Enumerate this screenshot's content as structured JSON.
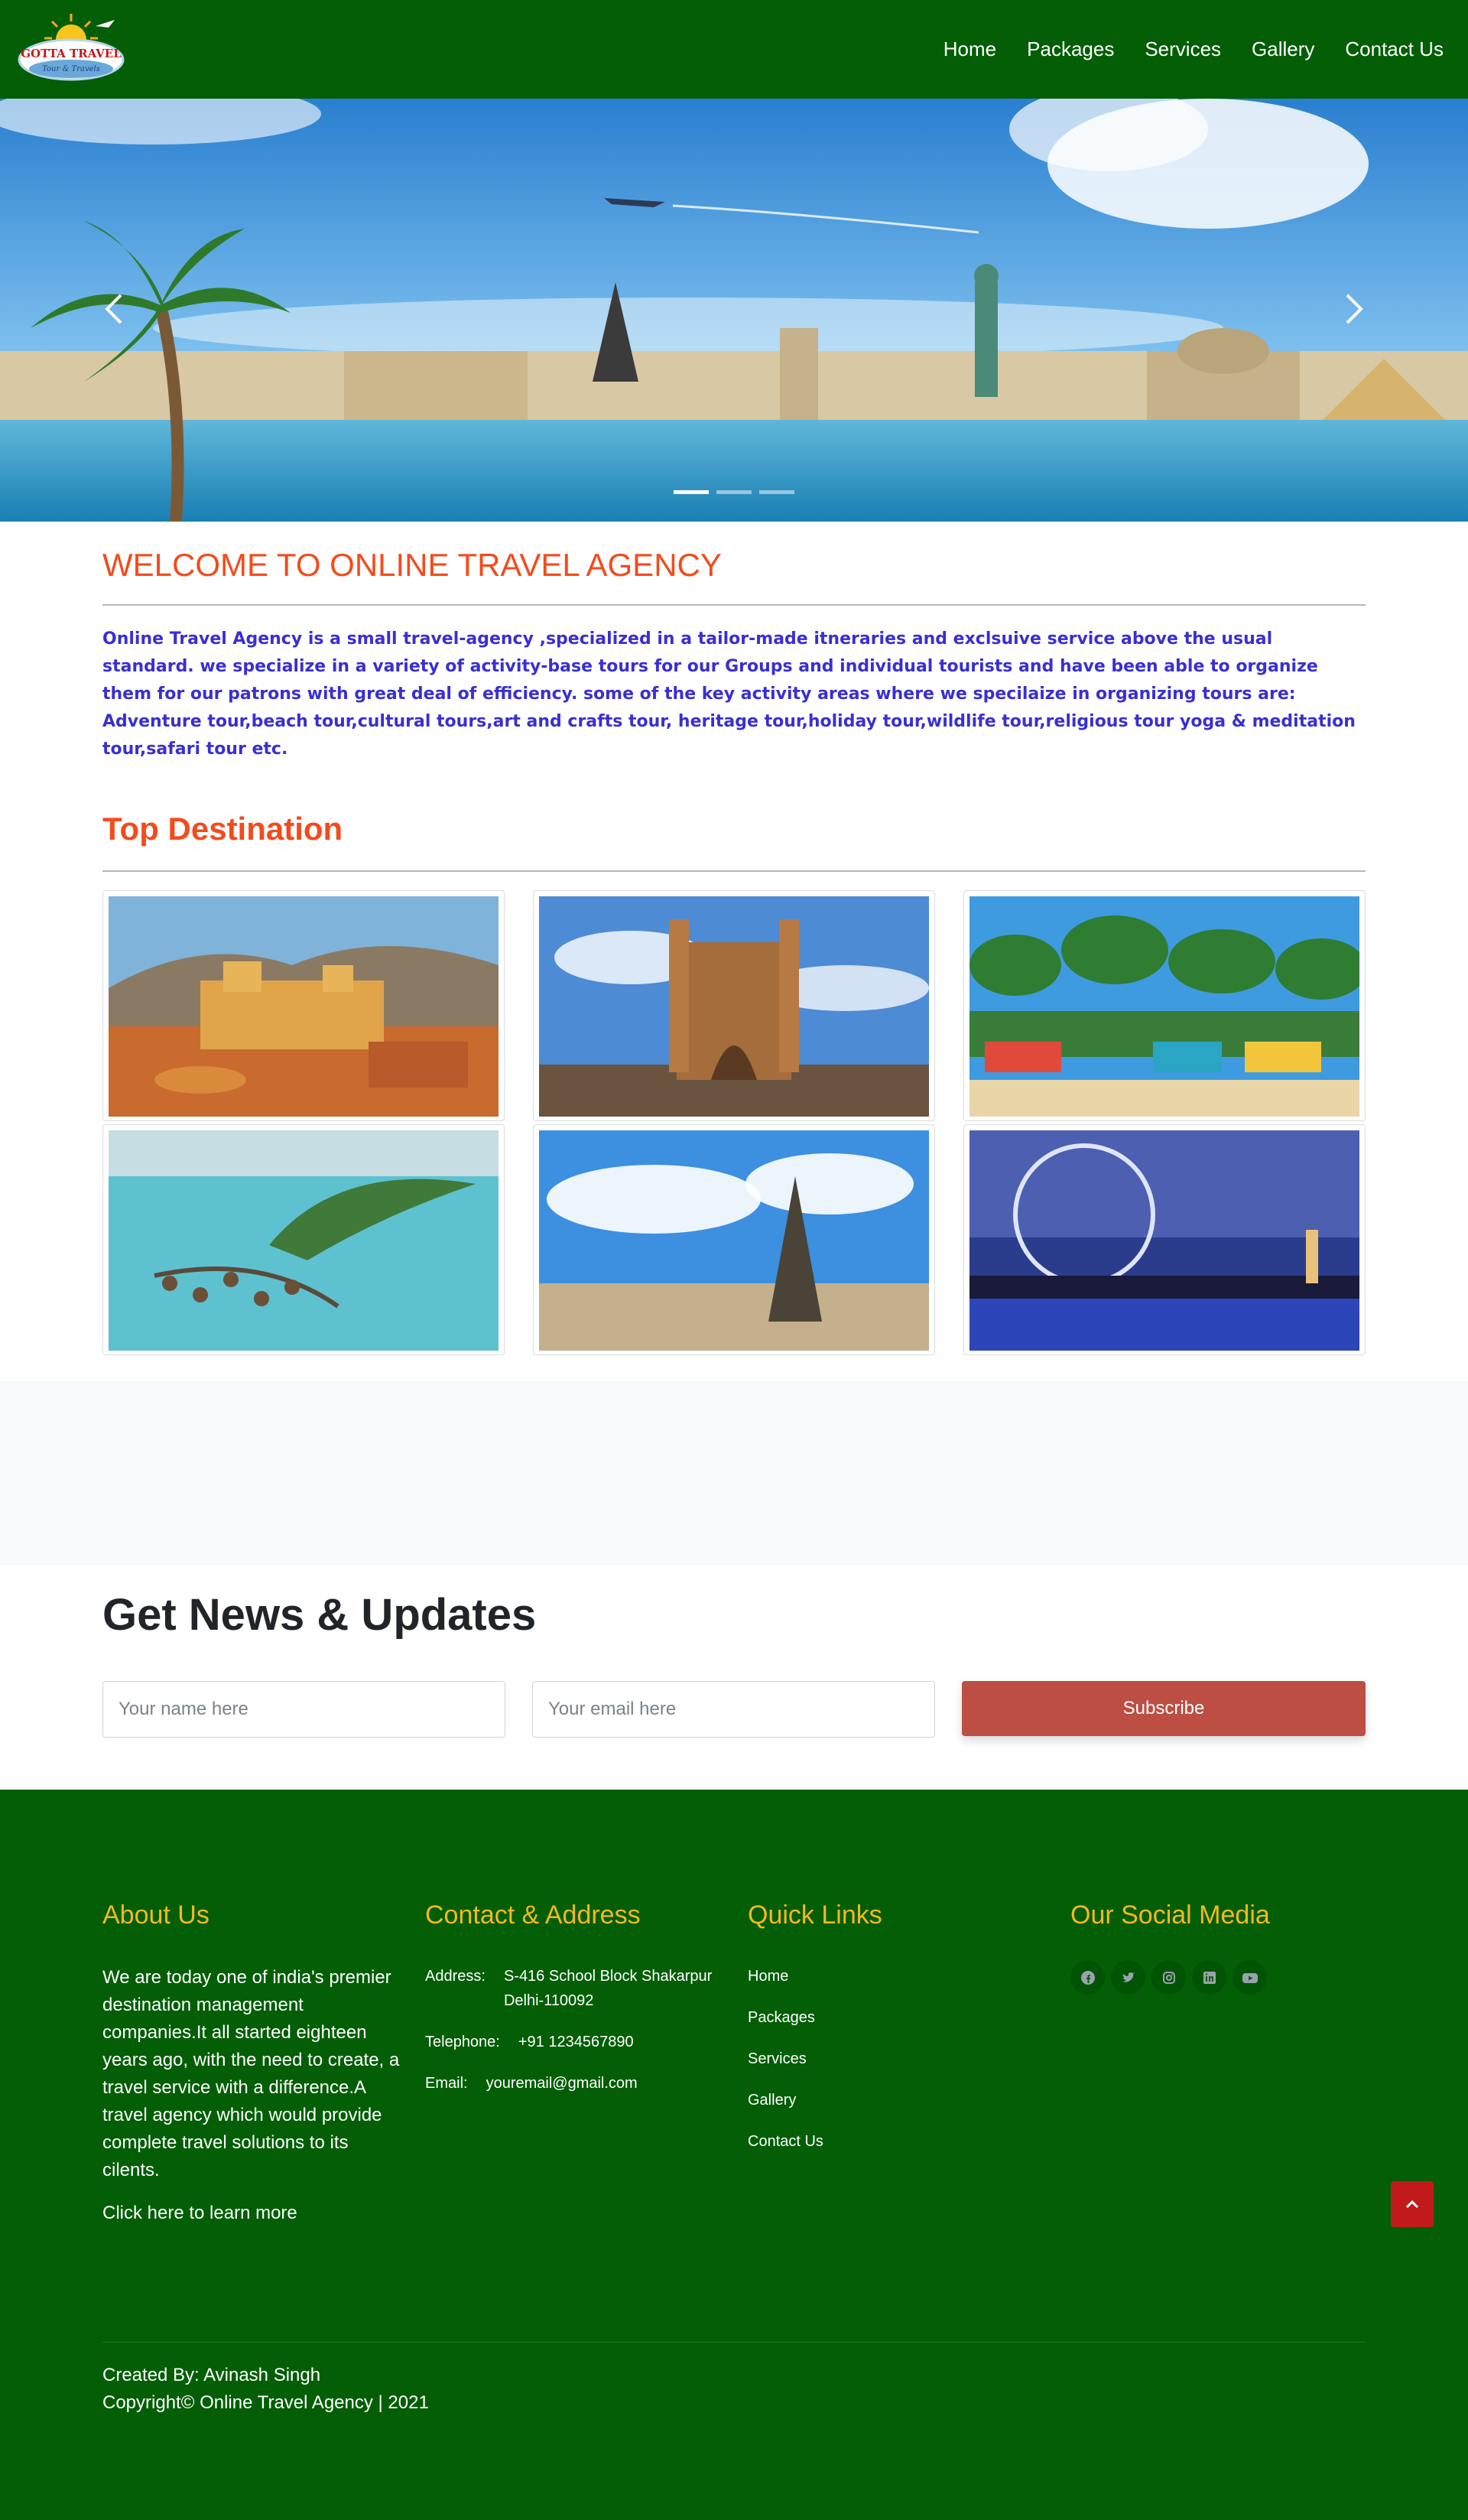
{
  "brand": {
    "logo_text": "GOTTA TRAVEL",
    "logo_subtext": "Tour & Travels"
  },
  "nav": {
    "items": [
      {
        "label": "Home"
      },
      {
        "label": "Packages"
      },
      {
        "label": "Services"
      },
      {
        "label": "Gallery"
      },
      {
        "label": "Contact Us"
      }
    ]
  },
  "carousel": {
    "slides": 3,
    "active_slide": 1,
    "prev_icon": "chevron-left-icon",
    "next_icon": "chevron-right-icon"
  },
  "welcome": {
    "title": "WELCOME TO ONLINE TRAVEL AGENCY",
    "text": "Online Travel Agency is a small travel-agency ,specialized in a tailor-made itneraries and exclsuive service above the usual standard. we specialize in a variety of activity-base tours for our Groups and individual tourists and have been able to organize them for our patrons with great deal of efficiency. some of the key activity areas where we specilaize in organizing tours are: Adventure tour,beach tour,cultural tours,art and crafts tour, heritage tour,holiday tour,wildlife tour,religious tour yoga & meditation tour,safari tour etc."
  },
  "destinations": {
    "title": "Top Destination"
  },
  "newsletter": {
    "title": "Get News & Updates",
    "name_placeholder": "Your name here",
    "email_placeholder": "Your email here",
    "subscribe_label": "Subscribe"
  },
  "footer": {
    "about": {
      "heading": "About Us",
      "text": "We are today one of india's premier destination management companies.It all started eighteen years ago, with the need to create, a travel service with a difference.A travel agency which would provide complete travel solutions to its cilents.",
      "link": "Click here to learn more"
    },
    "contact": {
      "heading": "Contact & Address",
      "address_label": "Address:",
      "address_line1": "S-416 School Block Shakarpur",
      "address_line2": "Delhi-110092",
      "telephone_label": "Telephone:",
      "telephone": "+91 1234567890",
      "email_label": "Email:",
      "email": "youremail@gmail.com"
    },
    "quick_links": {
      "heading": "Quick Links",
      "items": [
        "Home",
        "Packages",
        "Services",
        "Gallery",
        "Contact Us"
      ]
    },
    "social": {
      "heading": "Our Social Media",
      "icons": [
        "facebook-icon",
        "twitter-icon",
        "instagram-icon",
        "linkedin-icon",
        "youtube-icon"
      ]
    },
    "credit": "Created By: Avinash Singh",
    "copyright": "Copyright© Online Travel Agency | 2021"
  },
  "colors": {
    "nav_bg": "#035e06",
    "accent_orange": "#f24c1c",
    "welcome_text": "#3a2fd1",
    "footer_heading": "#f1b821",
    "subscribe_bg": "#bc4e44",
    "back_to_top": "#c21a1a"
  }
}
